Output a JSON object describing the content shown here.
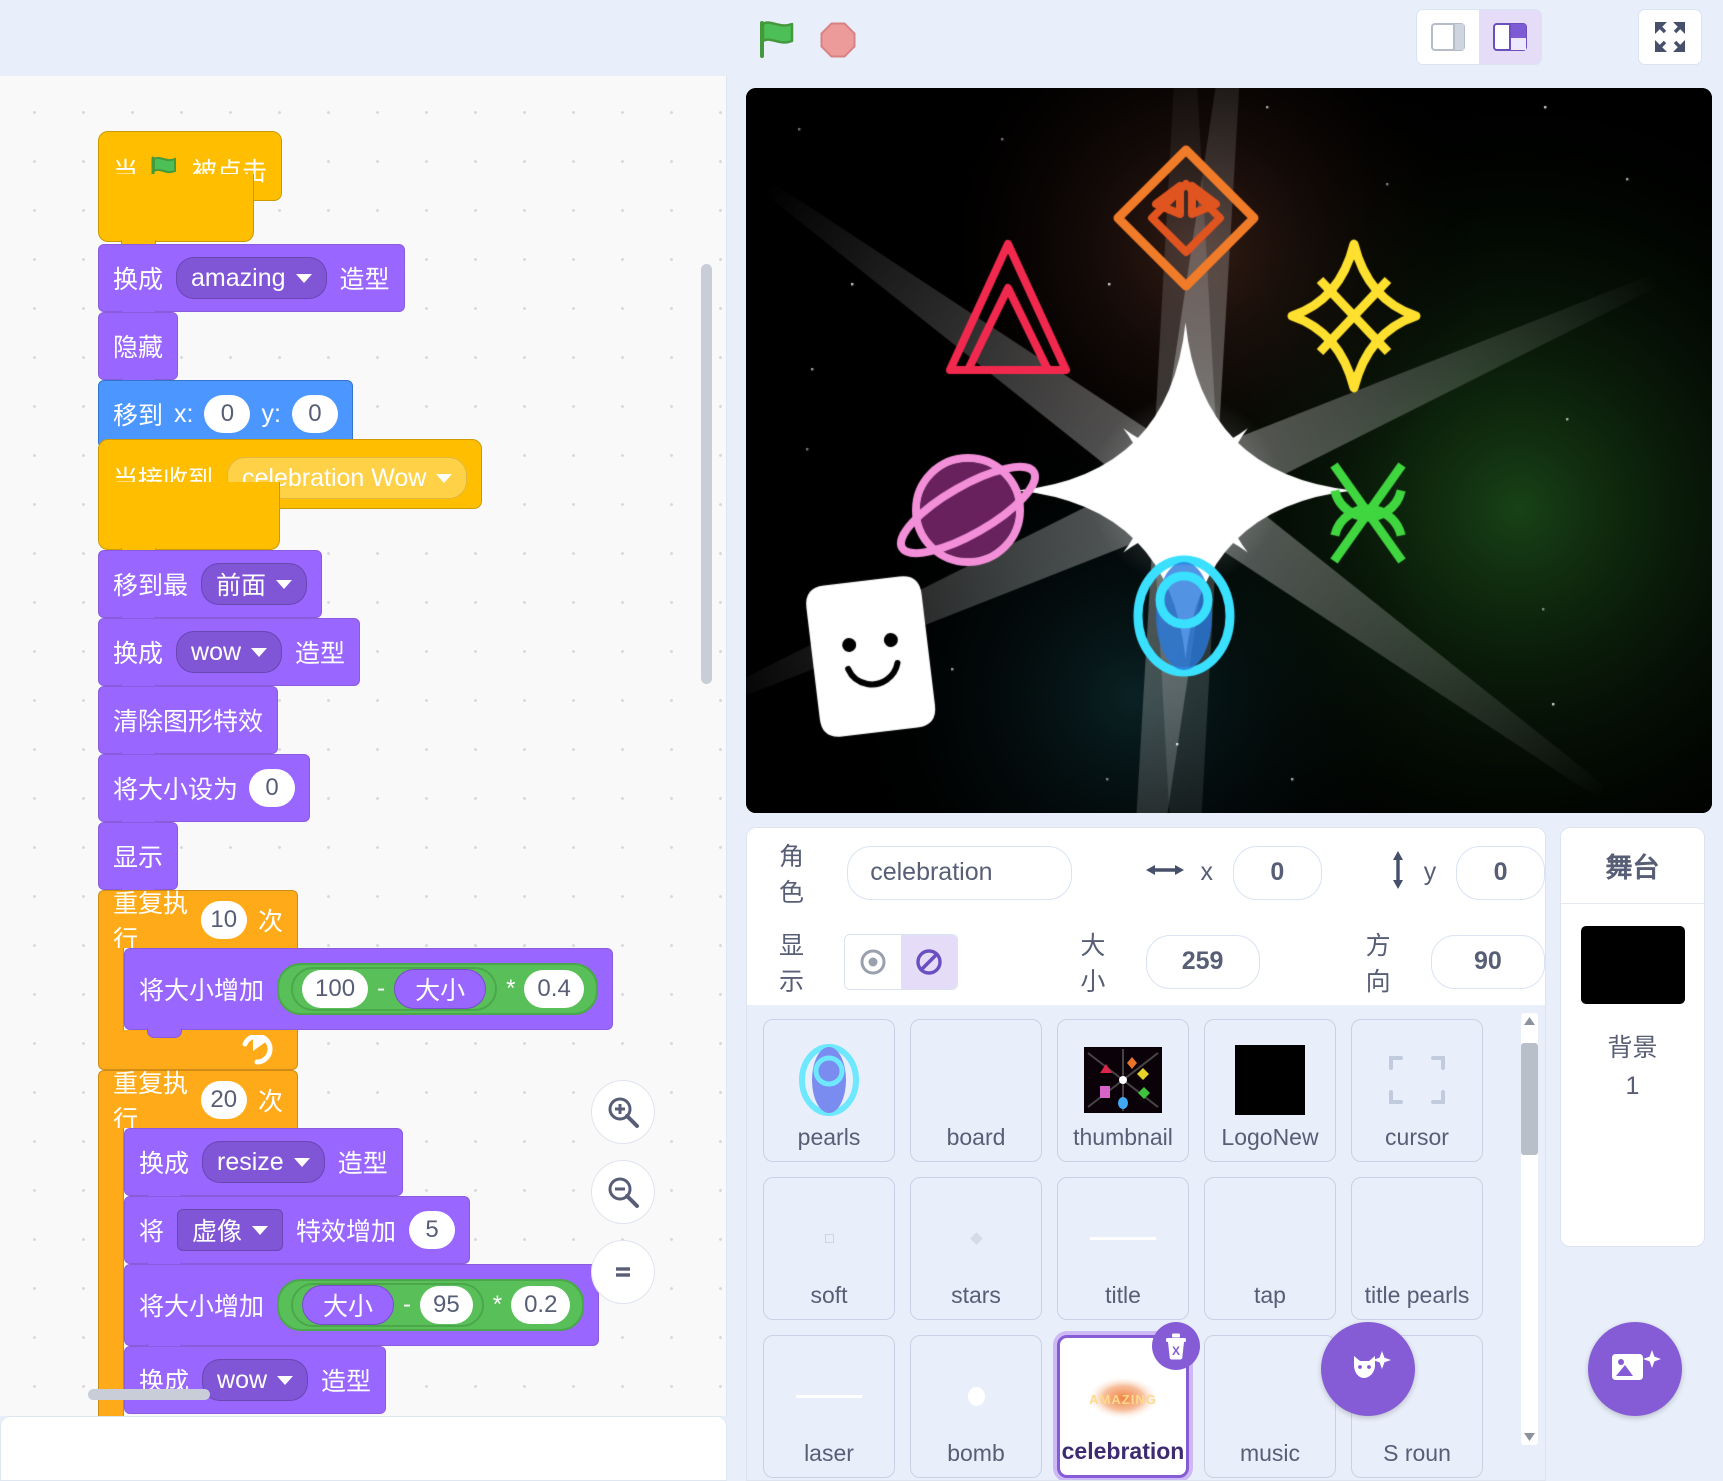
{
  "toolbar": {
    "green_flag_icon": "green-flag-icon",
    "stop_icon": "stop-sign-icon",
    "layout_small_label": "small-stage-layout",
    "layout_large_label": "large-stage-layout",
    "fullscreen_label": "fullscreen"
  },
  "code": {
    "script1": {
      "hat": {
        "pre": "当",
        "post": "被点击",
        "icon": "green-flag-icon"
      },
      "b1": {
        "pre": "换成",
        "dropdown": "amazing",
        "post": "造型"
      },
      "b2": {
        "label": "隐藏"
      },
      "b3": {
        "pre": "移到",
        "x_label": "x:",
        "x_value": "0",
        "y_label": "y:",
        "y_value": "0"
      }
    },
    "script2": {
      "hat": {
        "pre": "当接收到",
        "dropdown": "celebration Wow"
      },
      "b1": {
        "pre": "移到最",
        "dropdown": "前面"
      },
      "b2": {
        "pre": "换成",
        "dropdown": "wow",
        "post": "造型"
      },
      "b3": {
        "label": "清除图形特效"
      },
      "b4": {
        "pre": "将大小设为",
        "value": "0"
      },
      "b5": {
        "label": "显示"
      },
      "loop1": {
        "pre": "重复执行",
        "count": "10",
        "post": "次",
        "inner": {
          "pre": "将大小增加",
          "a": "100",
          "op1": "-",
          "var": "大小",
          "op2": "*",
          "b": "0.4"
        }
      },
      "loop2": {
        "pre": "重复执行",
        "count": "20",
        "post": "次",
        "i1": {
          "pre": "换成",
          "dropdown": "resize",
          "post": "造型"
        },
        "i2": {
          "pre": "将",
          "dropdown": "虚像",
          "mid": "特效增加",
          "value": "5"
        },
        "i3": {
          "pre": "将大小增加",
          "var": "大小",
          "op1": "-",
          "a": "95",
          "op2": "*",
          "b": "0.2"
        },
        "i4": {
          "pre": "换成",
          "dropdown": "wow",
          "post": "造型"
        }
      }
    },
    "zoom_in_icon": "zoom-in-icon",
    "zoom_out_icon": "zoom-out-icon",
    "zoom_reset_icon": "zoom-reset-icon"
  },
  "sprite_info": {
    "name_label": "角色",
    "name_value": "celebration",
    "x_label": "x",
    "x_value": "0",
    "y_label": "y",
    "y_value": "0",
    "show_label": "显示",
    "show_icon": "eye-icon",
    "hide_icon": "eye-slash-icon",
    "size_label": "大小",
    "size_value": "259",
    "direction_label": "方向",
    "direction_value": "90"
  },
  "sprites": [
    {
      "name": "pearls",
      "thumb": "pearls",
      "selected": false
    },
    {
      "name": "board",
      "thumb": "blank",
      "selected": false
    },
    {
      "name": "thumbnail",
      "thumb": "starfield",
      "selected": false
    },
    {
      "name": "LogoNew",
      "thumb": "black",
      "selected": false
    },
    {
      "name": "cursor",
      "thumb": "cursor",
      "selected": false
    },
    {
      "name": "soft",
      "thumb": "tinysq",
      "selected": false
    },
    {
      "name": "stars",
      "thumb": "tinydot",
      "selected": false
    },
    {
      "name": "title",
      "thumb": "line",
      "selected": false
    },
    {
      "name": "tap",
      "thumb": "blank",
      "selected": false
    },
    {
      "name": "title pearls",
      "thumb": "blank",
      "selected": false
    },
    {
      "name": "laser",
      "thumb": "line",
      "selected": false
    },
    {
      "name": "bomb",
      "thumb": "dot",
      "selected": false
    },
    {
      "name": "celebration",
      "thumb": "amazing",
      "selected": true
    },
    {
      "name": "music",
      "thumb": "blank",
      "selected": false
    },
    {
      "name": "S roun",
      "thumb": "blank",
      "selected": false
    }
  ],
  "add_sprite_icon": "add-sprite-cat-icon",
  "stage_pane": {
    "title": "舞台",
    "backdrop_label": "背景",
    "backdrop_count": "1",
    "add_backdrop_icon": "add-backdrop-icon"
  },
  "colors": {
    "looks": "#9966ff",
    "motion": "#4c97ff",
    "control": "#ffab19",
    "events": "#ffbf00",
    "operators": "#59c059",
    "accent": "#855cd6",
    "page_bg": "#e8effb"
  }
}
